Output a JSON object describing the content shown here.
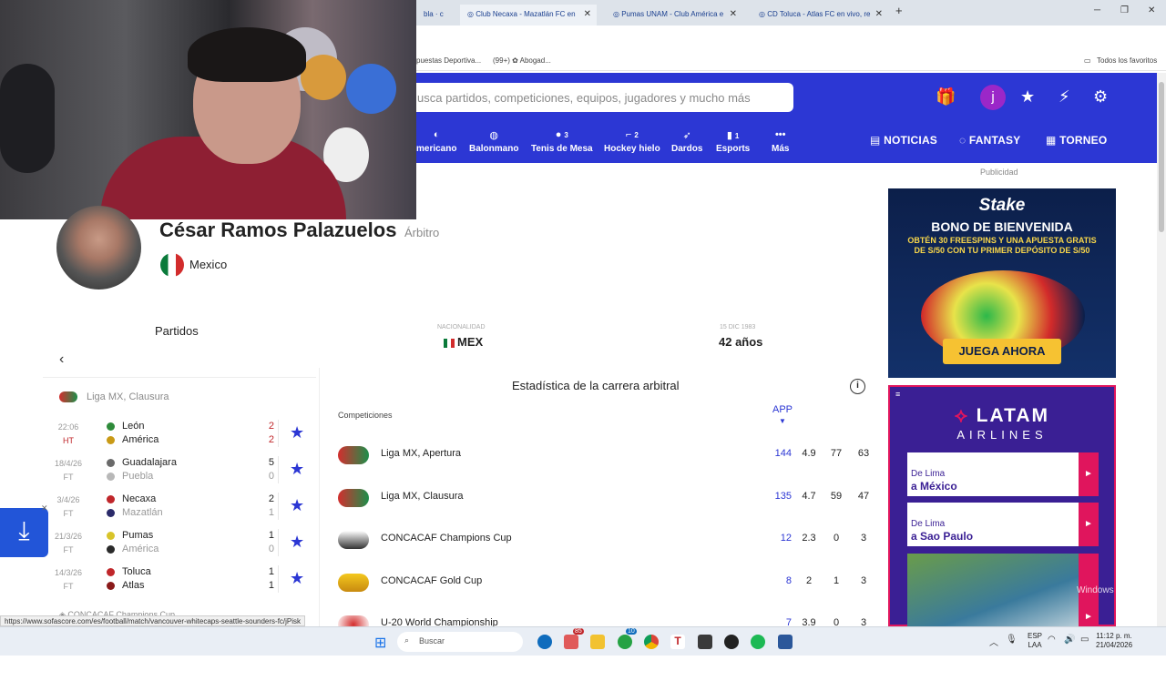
{
  "browser": {
    "tabs": [
      {
        "label": "bla · c"
      },
      {
        "label": "Club Necaxa - Mazatlán FC en"
      },
      {
        "label": "Pumas UNAM - Club América e"
      },
      {
        "label": "CD Toluca - Atlas FC en vivo, re"
      }
    ],
    "new_tab": "+",
    "bookmarks": [
      {
        "label": "puestas Deportiva..."
      },
      {
        "label": "(99+) ✿ Abogad..."
      }
    ],
    "all_bookmarks": "Todos los favoritos",
    "status_url": "https://www.sofascore.com/es/football/match/vancouver-whitecaps-seattle-sounders-fc/jPisk"
  },
  "header": {
    "search_placeholder": "usca partidos, competiciones, equipos, jugadores y mucho más",
    "avatar_letter": "j",
    "sports": [
      {
        "label": "mericano",
        "icon": "american-football-icon",
        "count": ""
      },
      {
        "label": "Balonmano",
        "icon": "handball-icon",
        "count": ""
      },
      {
        "label": "Tenis de Mesa",
        "icon": "table-tennis-icon",
        "count": "3"
      },
      {
        "label": "Hockey hielo",
        "icon": "ice-hockey-icon",
        "count": "2"
      },
      {
        "label": "Dardos",
        "icon": "darts-icon",
        "count": ""
      },
      {
        "label": "Esports",
        "icon": "esports-icon",
        "count": "1"
      },
      {
        "label": "Más",
        "icon": "more-icon",
        "count": ""
      }
    ],
    "nav": {
      "noticias": "NOTICIAS",
      "fantasy": "FANTASY",
      "torneo": "TORNEO"
    }
  },
  "referee": {
    "name": "César Ramos Palazuelos",
    "role": "Árbitro",
    "country": "Mexico",
    "nationality_label": "NACIONALIDAD",
    "nationality": "MEX",
    "birth_label": "15 DIC 1983",
    "age": "42 años"
  },
  "matches": {
    "title": "Partidos",
    "competition": "Liga MX, Clausura",
    "items": [
      {
        "time": "22:06",
        "status": "HT",
        "home": "León",
        "away": "América",
        "home_score": "2",
        "away_score": "2",
        "live": true
      },
      {
        "time": "18/4/26",
        "status": "FT",
        "home": "Guadalajara",
        "away": "Puebla",
        "home_score": "5",
        "away_score": "0",
        "live": false
      },
      {
        "time": "3/4/26",
        "status": "FT",
        "home": "Necaxa",
        "away": "Mazatlán",
        "home_score": "2",
        "away_score": "1",
        "live": false
      },
      {
        "time": "21/3/26",
        "status": "FT",
        "home": "Pumas",
        "away": "América",
        "home_score": "1",
        "away_score": "0",
        "live": false
      },
      {
        "time": "14/3/26",
        "status": "FT",
        "home": "Toluca",
        "away": "Atlas",
        "home_score": "1",
        "away_score": "1",
        "live": false
      }
    ],
    "next_competition": "CONCACAF Champions Cup"
  },
  "stats": {
    "title": "Estadística de la carrera arbitral",
    "comp_header": "Competiciones",
    "app_header": "APP",
    "rows": [
      {
        "name": "Liga MX, Apertura",
        "app": "144",
        "c1": "4.9",
        "c2": "77",
        "c3": "63"
      },
      {
        "name": "Liga MX, Clausura",
        "app": "135",
        "c1": "4.7",
        "c2": "59",
        "c3": "47"
      },
      {
        "name": "CONCACAF Champions Cup",
        "app": "12",
        "c1": "2.3",
        "c2": "0",
        "c3": "3"
      },
      {
        "name": "CONCACAF Gold Cup",
        "app": "8",
        "c1": "2",
        "c2": "1",
        "c3": "3"
      },
      {
        "name": "U-20 World Championship",
        "app": "7",
        "c1": "3.9",
        "c2": "0",
        "c3": "3"
      }
    ]
  },
  "ads": {
    "label": "Publicidad",
    "stake": {
      "brand": "Stake",
      "headline": "BONO DE BIENVENIDA",
      "sub": "OBTÉN 30 FREESPINS Y UNA APUESTA GRATIS DE S/50 CON TU PRIMER DEPÓSITO DE S/50",
      "cta": "JUEGA AHORA"
    },
    "latam": {
      "brand": "LATAM",
      "sub": "AIRLINES",
      "cards": [
        {
          "line1": "De Lima",
          "line2": "a México"
        },
        {
          "line1": "De Lima",
          "line2": "a Sao Paulo"
        }
      ]
    }
  },
  "taskbar": {
    "search": "Buscar",
    "lang1": "ESP",
    "lang2": "LAA",
    "time": "11:12 p. m.",
    "date": "21/04/2026",
    "notif_badge": "85",
    "whatsapp_badge": "10"
  },
  "watermark": "Windows"
}
